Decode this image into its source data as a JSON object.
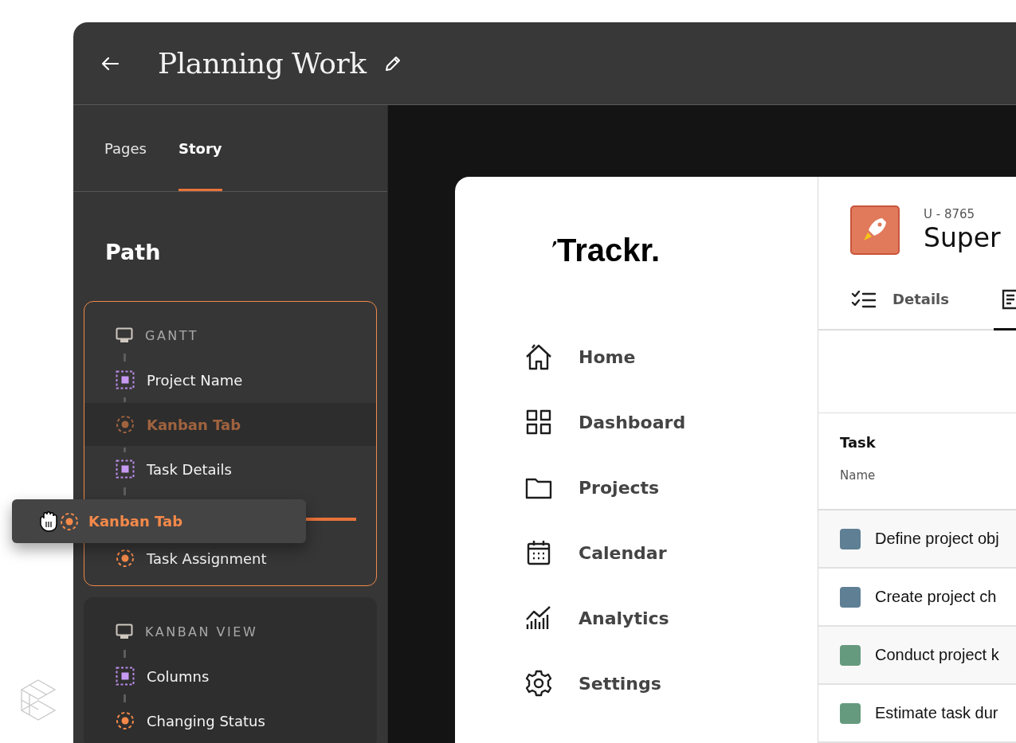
{
  "header": {
    "title": "Planning Work"
  },
  "tabs": [
    {
      "label": "Pages",
      "selected": false
    },
    {
      "label": "Story",
      "selected": true
    }
  ],
  "path": {
    "title": "Path",
    "groups": [
      {
        "title": "GANTT",
        "highlighted": true,
        "items": [
          {
            "kind": "element",
            "label": "Project Name",
            "dragging": false
          },
          {
            "kind": "interaction",
            "label": "Kanban Tab",
            "dragging": true
          },
          {
            "kind": "element",
            "label": "Task Details",
            "dragging": false
          },
          {
            "kind": "drop_slot"
          },
          {
            "kind": "interaction",
            "label": "Task Assignment",
            "dragging": false
          }
        ]
      },
      {
        "title": "KANBAN VIEW",
        "highlighted": false,
        "items": [
          {
            "kind": "element",
            "label": "Columns",
            "dragging": false
          },
          {
            "kind": "interaction",
            "label": "Changing Status",
            "dragging": false
          }
        ]
      }
    ]
  },
  "drag_ghost": {
    "kind": "interaction",
    "label": "Kanban Tab"
  },
  "app": {
    "logo": "Trackr.",
    "nav": [
      {
        "label": "Home"
      },
      {
        "label": "Dashboard"
      },
      {
        "label": "Projects"
      },
      {
        "label": "Calendar"
      },
      {
        "label": "Analytics"
      },
      {
        "label": "Settings"
      }
    ],
    "issue": {
      "id": "U - 8765",
      "title": "Super"
    },
    "detail_tabs": [
      {
        "label": "Details",
        "selected": false
      },
      {
        "selected": true
      }
    ],
    "table": {
      "group": "Task",
      "column": "Name",
      "rows": [
        {
          "name": "Define project obj",
          "color": "#5f7f94"
        },
        {
          "name": "Create project ch",
          "color": "#5f7f94"
        },
        {
          "name": "Conduct project k",
          "color": "#669a7e"
        },
        {
          "name": "Estimate task dur",
          "color": "#669a7e"
        }
      ]
    }
  }
}
